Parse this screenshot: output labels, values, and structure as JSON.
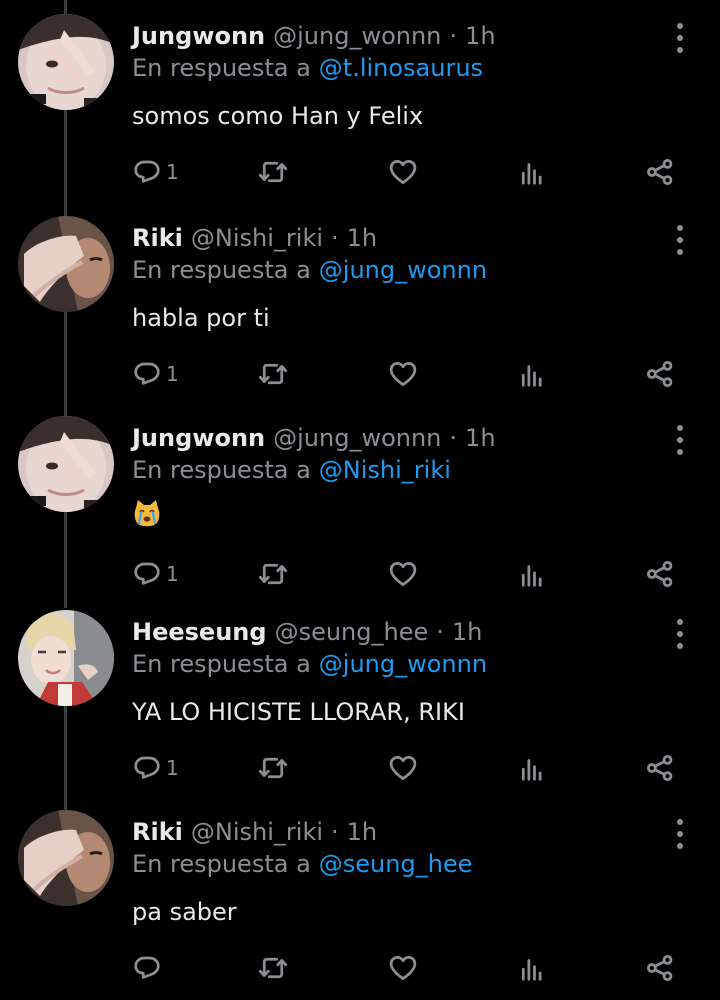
{
  "theme": {
    "background": "#000000",
    "text": "#e7e9ea",
    "muted": "#8b8f94",
    "link": "#1d9bf0"
  },
  "tweets": [
    {
      "name": "Jungwonn",
      "handle": "@jung_wonnn",
      "separator": "·",
      "time": "1h",
      "reply_label": "En respuesta a",
      "reply_to": "@t.linosaurus",
      "text": "somos como Han y Felix",
      "reply_count": "1",
      "avatar_icon": "avatar-peace-sign-photo"
    },
    {
      "name": "Riki",
      "handle": "@Nishi_riki",
      "separator": "·",
      "time": "1h",
      "reply_label": "En respuesta a",
      "reply_to": "@jung_wonnn",
      "text": "habla por ti",
      "reply_count": "1",
      "avatar_icon": "avatar-hand-cover-photo"
    },
    {
      "name": "Jungwonn",
      "handle": "@jung_wonnn",
      "separator": "·",
      "time": "1h",
      "reply_label": "En respuesta a",
      "reply_to": "@Nishi_riki",
      "text": "",
      "emoji": "crying-cat-emoji",
      "reply_count": "1",
      "avatar_icon": "avatar-peace-sign-photo"
    },
    {
      "name": "Heeseung",
      "handle": "@seung_hee",
      "separator": "·",
      "time": "1h",
      "reply_label": "En respuesta a",
      "reply_to": "@jung_wonnn",
      "text": "YA LO HICISTE LLORAR, RIKI",
      "reply_count": "1",
      "avatar_icon": "avatar-blond-photo"
    },
    {
      "name": "Riki",
      "handle": "@Nishi_riki",
      "separator": "·",
      "time": "1h",
      "reply_label": "En respuesta a",
      "reply_to": "@seung_hee",
      "text": "pa saber",
      "reply_count": "",
      "avatar_icon": "avatar-hand-cover-photo"
    }
  ]
}
